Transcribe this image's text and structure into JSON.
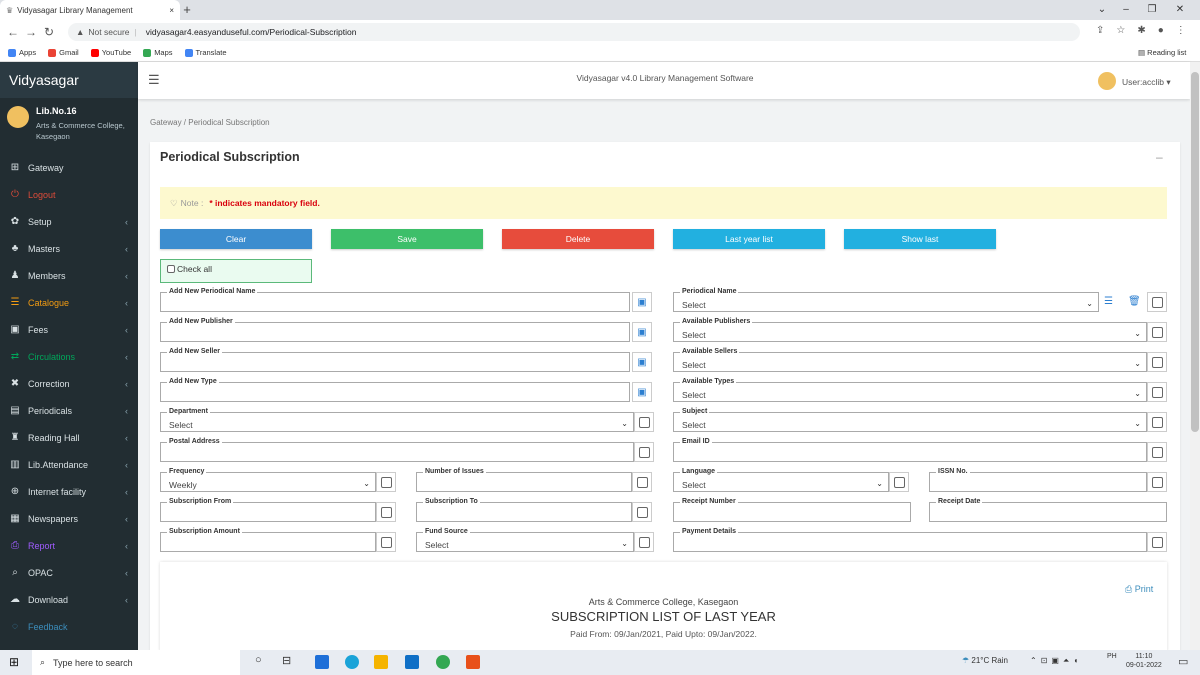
{
  "browser": {
    "tab_title": "Vidyasagar Library Management",
    "tab_close": "×",
    "new_tab": "+",
    "not_secure": "Not secure",
    "url": "vidyasagar4.easyanduseful.com/Periodical-Subscription",
    "bookmarks": [
      "Apps",
      "Gmail",
      "YouTube",
      "Maps",
      "Translate"
    ],
    "reading_list": "Reading list",
    "min": "–",
    "max": "❐",
    "close": "✕"
  },
  "sidebar": {
    "brand": "Vidyasagar",
    "lib_no": "Lib.No.16",
    "college": "Arts & Commerce College, Kasegaon",
    "items": [
      {
        "label": "Gateway",
        "icon": "⊞",
        "color": "#d9e1e4",
        "chev": ""
      },
      {
        "label": "Logout",
        "icon": "⏻",
        "color": "#dd4b39",
        "chev": ""
      },
      {
        "label": "Setup",
        "icon": "✿",
        "color": "#d9e1e4",
        "chev": "‹"
      },
      {
        "label": "Masters",
        "icon": "♣",
        "color": "#d9e1e4",
        "chev": "‹"
      },
      {
        "label": "Members",
        "icon": "♟",
        "color": "#d9e1e4",
        "chev": "‹"
      },
      {
        "label": "Catalogue",
        "icon": "☰",
        "color": "#f39c12",
        "chev": "‹"
      },
      {
        "label": "Fees",
        "icon": "▣",
        "color": "#d9e1e4",
        "chev": "‹"
      },
      {
        "label": "Circulations",
        "icon": "⇄",
        "color": "#00a65a",
        "chev": "‹"
      },
      {
        "label": "Correction",
        "icon": "✖",
        "color": "#d9e1e4",
        "chev": "‹"
      },
      {
        "label": "Periodicals",
        "icon": "▤",
        "color": "#d9e1e4",
        "chev": "‹"
      },
      {
        "label": "Reading Hall",
        "icon": "♜",
        "color": "#d9e1e4",
        "chev": "‹"
      },
      {
        "label": "Lib.Attendance",
        "icon": "▥",
        "color": "#d9e1e4",
        "chev": "‹"
      },
      {
        "label": "Internet facility",
        "icon": "⊕",
        "color": "#d9e1e4",
        "chev": "‹"
      },
      {
        "label": "Newspapers",
        "icon": "▦",
        "color": "#d9e1e4",
        "chev": "‹"
      },
      {
        "label": "Report",
        "icon": "⎙",
        "color": "#a05cff",
        "chev": "‹"
      },
      {
        "label": "OPAC",
        "icon": "⌕",
        "color": "#d9e1e4",
        "chev": "‹"
      },
      {
        "label": "Download",
        "icon": "☁",
        "color": "#d9e1e4",
        "chev": "‹"
      },
      {
        "label": "Feedback",
        "icon": "◌",
        "color": "#3c8dbc",
        "chev": ""
      }
    ]
  },
  "header": {
    "title": "Vidyasagar v4.0 Library Management Software",
    "user": "User:acclib"
  },
  "breadcrumb": "Gateway / Periodical Subscription",
  "page_title": "Periodical Subscription",
  "collapse": "–",
  "note": {
    "label": "Note :",
    "required": "* indicates mandatory field."
  },
  "buttons": {
    "clear": "Clear",
    "save": "Save",
    "delete": "Delete",
    "last_year": "Last year list",
    "show_last": "Show last"
  },
  "check_all": "Check all",
  "fields": {
    "add_periodical": {
      "label": "Add New Periodical Name",
      "value": ""
    },
    "add_publisher": {
      "label": "Add New Publisher",
      "value": ""
    },
    "add_seller": {
      "label": "Add New Seller",
      "value": ""
    },
    "add_type": {
      "label": "Add New Type",
      "value": ""
    },
    "periodical_name": {
      "label": "Periodical Name",
      "value": "Select"
    },
    "publishers": {
      "label": "Available Publishers",
      "value": "Select"
    },
    "sellers": {
      "label": "Available Sellers",
      "value": "Select"
    },
    "types": {
      "label": "Available Types",
      "value": "Select"
    },
    "department": {
      "label": "Department",
      "value": "Select"
    },
    "subject": {
      "label": "Subject",
      "value": "Select"
    },
    "postal": {
      "label": "Postal Address",
      "value": ""
    },
    "email": {
      "label": "Email ID",
      "value": ""
    },
    "frequency": {
      "label": "Frequency",
      "value": "Weekly"
    },
    "issues": {
      "label": "Number of Issues",
      "value": ""
    },
    "language": {
      "label": "Language",
      "value": "Select"
    },
    "issn": {
      "label": "ISSN No.",
      "value": ""
    },
    "sub_from": {
      "label": "Subscription From",
      "value": ""
    },
    "sub_to": {
      "label": "Subscription To",
      "value": ""
    },
    "receipt_no": {
      "label": "Receipt Number",
      "value": ""
    },
    "receipt_date": {
      "label": "Receipt Date",
      "value": ""
    },
    "amount": {
      "label": "Subscription Amount",
      "value": ""
    },
    "fund": {
      "label": "Fund Source",
      "value": "Select"
    },
    "payment": {
      "label": "Payment Details",
      "value": ""
    }
  },
  "report": {
    "print": "Print",
    "college": "Arts & Commerce College, Kasegaon",
    "title": "SUBSCRIPTION LIST OF LAST YEAR",
    "subtitle": "Paid From: 09/Jan/2021, Paid Upto: 09/Jan/2022."
  },
  "taskbar": {
    "search_placeholder": "Type here to search",
    "weather": "21°C  Rain",
    "time": "11:10",
    "date": "09-01-2022",
    "lang": "PH"
  }
}
